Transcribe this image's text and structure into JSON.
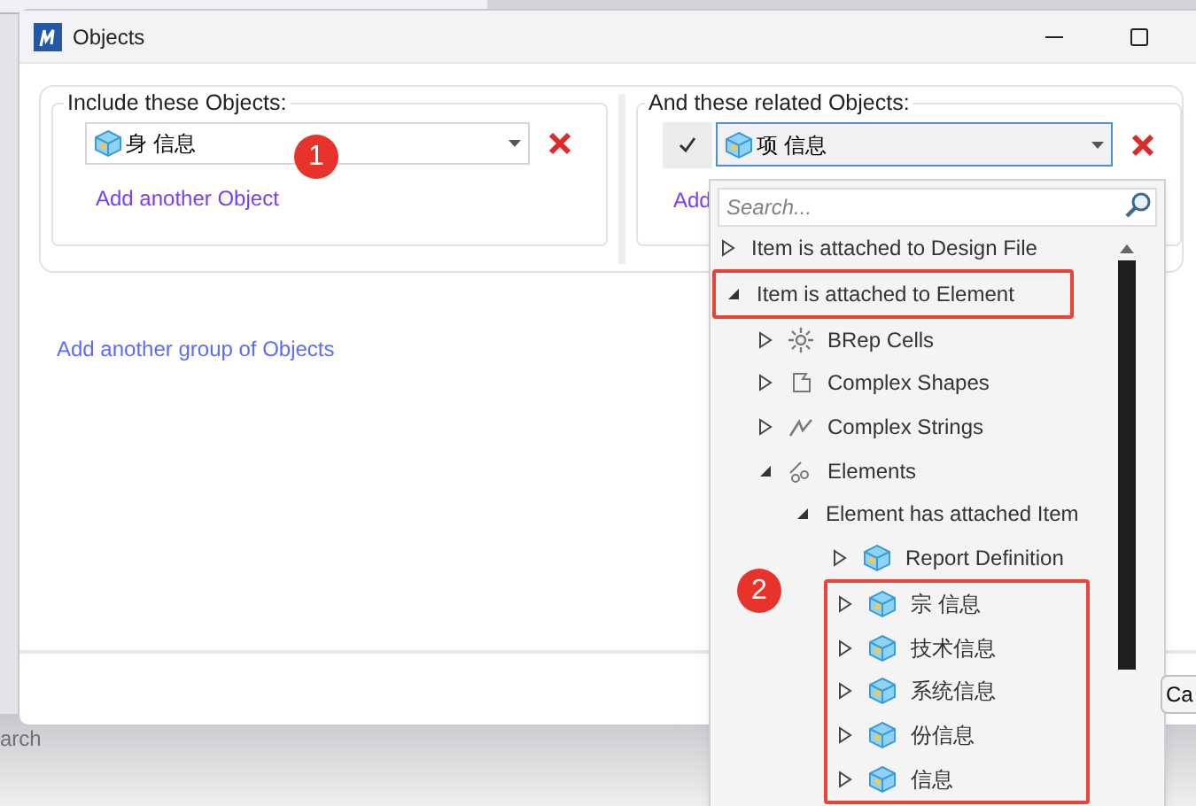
{
  "background_app": {
    "search_text": "arch",
    "button_text": "Ca"
  },
  "window": {
    "title": "Objects"
  },
  "include_group": {
    "legend": "Include these Objects:",
    "object": {
      "value": "身 信息"
    },
    "add_link": "Add another Object"
  },
  "related_group": {
    "legend": "And these related Objects:",
    "checked": true,
    "object": {
      "value": "项 信息"
    },
    "add_link": "Add"
  },
  "add_group_link": "Add another group of Objects",
  "dropdown": {
    "search": {
      "placeholder": "Search..."
    },
    "tree": [
      {
        "label": "Item is attached to Design File",
        "expanded": false,
        "highlight": false
      },
      {
        "label": "Item is attached to Element",
        "expanded": true,
        "highlight": true,
        "children": [
          {
            "label": "BRep Cells",
            "kind": "brep",
            "expanded": false,
            "highlight": false
          },
          {
            "label": "Complex Shapes",
            "kind": "shape",
            "expanded": false,
            "highlight": false
          },
          {
            "label": "Complex Strings",
            "kind": "string",
            "expanded": false,
            "highlight": false
          },
          {
            "label": "Elements",
            "kind": "elements",
            "expanded": true,
            "highlight": false,
            "children": [
              {
                "label": "Element has attached Item",
                "expanded": true,
                "highlight": false,
                "children": [
                  {
                    "label": "Report Definition",
                    "kind": "object",
                    "expanded": false,
                    "highlight": false
                  },
                  {
                    "label": "宗 信息",
                    "kind": "object",
                    "expanded": false,
                    "highlight": true
                  },
                  {
                    "label": "技术信息",
                    "kind": "object",
                    "expanded": false,
                    "highlight": true
                  },
                  {
                    "label": "系统信息",
                    "kind": "object",
                    "expanded": false,
                    "highlight": true
                  },
                  {
                    "label": "份信息",
                    "kind": "object",
                    "expanded": false,
                    "highlight": true
                  },
                  {
                    "label": "信息",
                    "kind": "object",
                    "expanded": false,
                    "highlight": true
                  }
                ]
              }
            ]
          }
        ]
      }
    ]
  },
  "badges": [
    {
      "text": "1"
    },
    {
      "text": "2"
    }
  ]
}
